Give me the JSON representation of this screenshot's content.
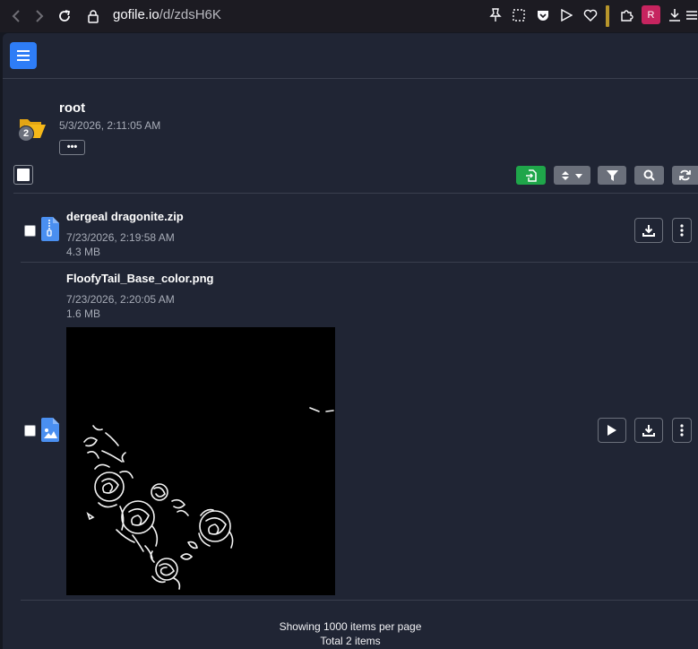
{
  "browser": {
    "url_host": "gofile.io",
    "url_path": "/d/zdsH6K",
    "profile_initial": "R"
  },
  "folder": {
    "title": "root",
    "date": "5/3/2026, 2:11:05 AM",
    "item_count": "2",
    "more_label": "•••"
  },
  "files": [
    {
      "name": "dergeal dragonite.zip",
      "date": "7/23/2026, 2:19:58 AM",
      "size": "4.3 MB",
      "icon": "zip-file-icon"
    },
    {
      "name": "FloofyTail_Base_color.png",
      "date": "7/23/2026, 2:20:05 AM",
      "size": "1.6 MB",
      "icon": "image-file-icon"
    }
  ],
  "footer": {
    "per_page": "Showing 1000 items per page",
    "total": "Total 2 items"
  },
  "colors": {
    "accent": "#2e7df6",
    "success": "#1fa64a",
    "panel": "#202534",
    "folder": "#f5b819"
  }
}
